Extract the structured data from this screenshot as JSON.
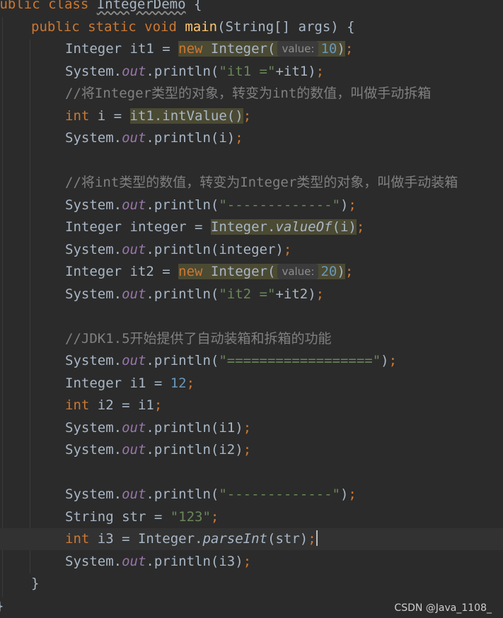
{
  "editor": {
    "class_decl": {
      "kw": "public class ",
      "name": "IntegerDemo",
      "brace": " {"
    },
    "main_decl": {
      "kw": "public static void ",
      "name": "main",
      "params": "(String[] args) {"
    },
    "inlay_hint": "value:",
    "code": {
      "l1": {
        "pre": "Integer it1 = ",
        "new_kw": "new",
        "ctor": " Integer(",
        "arg": "10",
        "close": ")",
        "semi": ";"
      },
      "l2": {
        "pre": "System.",
        "out": "out",
        "call": ".println(",
        "s": "\"it1 =\"",
        "rest": "+it1)",
        "semi": ";"
      },
      "l3": {
        "comment": "//将Integer类型的对象，转变为int的数值，叫做手动拆箱"
      },
      "l4": {
        "kw": "int",
        "pre": " i = ",
        "hl": "it1.intValue()",
        "semi": ";"
      },
      "l5": {
        "pre": "System.",
        "out": "out",
        "rest": ".println(i)",
        "semi": ";"
      },
      "l7": {
        "comment": "//将int类型的数值，转变为Integer类型的对象，叫做手动装箱"
      },
      "l8": {
        "pre": "System.",
        "out": "out",
        "call": ".println(",
        "s": "\"-------------\"",
        "close": ")",
        "semi": ";"
      },
      "l9": {
        "pre": "Integer integer = ",
        "cls": "Integer.",
        "method": "valueOf",
        "args": "(i)",
        "semi": ";"
      },
      "l10": {
        "pre": "System.",
        "out": "out",
        "rest": ".println(integer)",
        "semi": ";"
      },
      "l11": {
        "pre": "Integer it2 = ",
        "new_kw": "new",
        "ctor": " Integer(",
        "arg": "20",
        "close": ")",
        "semi": ";"
      },
      "l12": {
        "pre": "System.",
        "out": "out",
        "call": ".println(",
        "s": "\"it2 =\"",
        "rest": "+it2)",
        "semi": ";"
      },
      "l14": {
        "comment": "//JDK1.5开始提供了自动装箱和拆箱的功能"
      },
      "l15": {
        "pre": "System.",
        "out": "out",
        "call": ".println(",
        "s": "\"==================\"",
        "close": ")",
        "semi": ";"
      },
      "l16": {
        "pre": "Integer i1 = ",
        "num": "12",
        "semi": ";"
      },
      "l17": {
        "kw": "int",
        "pre": " i2 = i1",
        "semi": ";"
      },
      "l18": {
        "pre": "System.",
        "out": "out",
        "rest": ".println(i1)",
        "semi": ";"
      },
      "l19": {
        "pre": "System.",
        "out": "out",
        "rest": ".println(i2)",
        "semi": ";"
      },
      "l21": {
        "pre": "System.",
        "out": "out",
        "call": ".println(",
        "s": "\"-------------\"",
        "close": ")",
        "semi": ";"
      },
      "l22": {
        "pre": "String str = ",
        "s": "\"123\"",
        "semi": ";"
      },
      "l23": {
        "kw": "int",
        "pre": " i3 = Integer.",
        "method": "parseInt",
        "args": "(str)",
        "semi": ";"
      },
      "l24": {
        "pre": "System.",
        "out": "out",
        "rest": ".println(i3)",
        "semi": ";"
      }
    },
    "close_method": "}",
    "close_class": "}"
  },
  "watermark": "CSDN @Java_1108_",
  "colors": {
    "background": "#2b2b2b",
    "keyword": "#cc7832",
    "method_decl": "#ffc66d",
    "static_field": "#9876aa",
    "string": "#6a8759",
    "number": "#6897bb",
    "comment": "#808080",
    "highlight": "#4b4a33"
  }
}
